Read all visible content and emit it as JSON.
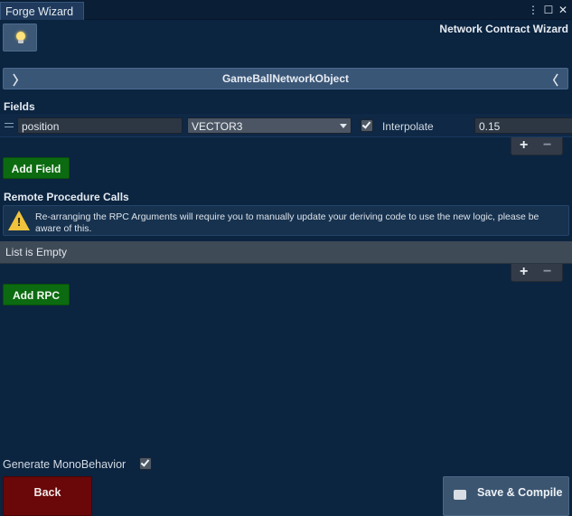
{
  "window": {
    "tab_title": "Forge Wizard",
    "menu_glyph": "⋮",
    "maximize_glyph": "☐",
    "close_glyph": "✕"
  },
  "header": {
    "title": "Network Contract Wizard",
    "hint_icon": "lightbulb-icon"
  },
  "object_bar": {
    "name": "GameBallNetworkObject",
    "left_arrow": "〉",
    "right_arrow": "〈"
  },
  "fields_section": {
    "label": "Fields",
    "rows": [
      {
        "name": "position",
        "type": "VECTOR3",
        "interpolate_checked": true,
        "interpolate_label": "Interpolate",
        "interpolate_value": "0.15"
      }
    ],
    "add_label": "Add Field",
    "plus": "+",
    "minus": "−"
  },
  "rpc_section": {
    "label": "Remote Procedure Calls",
    "warning": "Re-arranging the RPC Arguments will require you to manually update your deriving code to use the new logic, please be aware of this.",
    "empty_text": "List is Empty",
    "add_label": "Add RPC",
    "plus": "+",
    "minus": "−"
  },
  "footer": {
    "mono_label": "Generate MonoBehavior",
    "mono_checked": true,
    "back_label": "Back",
    "save_label": "Save & Compile"
  },
  "colors": {
    "background": "#0b2440",
    "add_button": "#0c6b10",
    "back_button": "#6a0708",
    "warning": "#f0c33c"
  }
}
